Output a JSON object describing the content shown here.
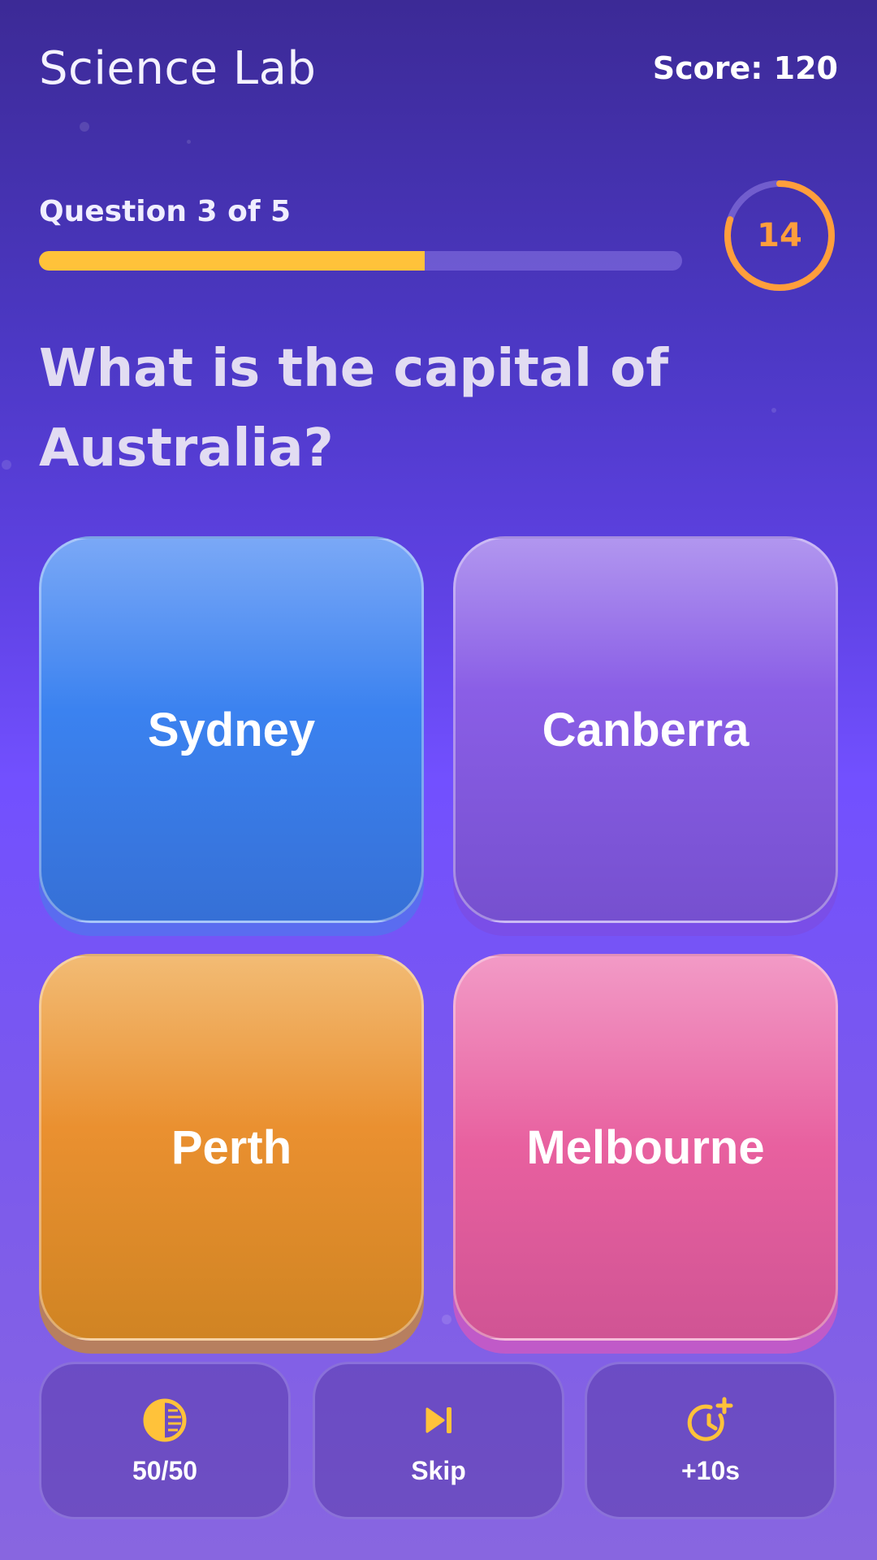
{
  "header": {
    "title": "Science Lab",
    "score": "Score: 120"
  },
  "progress": {
    "label": "Question 3 of 5",
    "fraction": 0.6
  },
  "timer": {
    "value": "14",
    "remaining_fraction": 0.8
  },
  "question": "What is the capital of Australia?",
  "answers": [
    {
      "label": "Sydney"
    },
    {
      "label": "Canberra"
    },
    {
      "label": "Perth"
    },
    {
      "label": "Melbourne"
    }
  ],
  "lifelines": [
    {
      "label": "50/50",
      "icon": "half-circle-icon"
    },
    {
      "label": "Skip",
      "icon": "skip-next-icon"
    },
    {
      "label": "+10s",
      "icon": "clock-plus-icon"
    }
  ],
  "colors": {
    "accent": "#ffc23a",
    "timer": "#ff9e3c"
  }
}
